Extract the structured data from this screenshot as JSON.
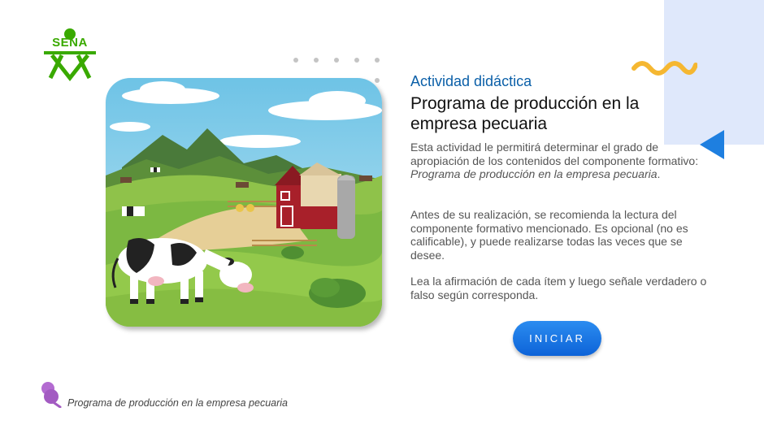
{
  "logo": {
    "text": "SENA",
    "color": "#39a900"
  },
  "header": {
    "subtitle": "Actividad didáctica",
    "title": "Programa de producción en la empresa pecuaria"
  },
  "body": {
    "p1_start": "Esta actividad le permitirá determinar el grado de apropiación de los contenidos del componente formativo: ",
    "p1_italic": "Programa de producción en la empresa pecuaria",
    "p1_end": ".",
    "p2": "Antes de su realización, se recomienda la lectura del componente formativo mencionado. Es opcional (no es calificable), y puede realizarse todas las veces que se desee.",
    "p3": "Lea la afirmación de cada ítem y luego señale verdadero o falso según corresponda."
  },
  "start_button": {
    "label": "INICIAR",
    "color": "#1a73e8"
  },
  "footer": {
    "text": "Programa de producción en la empresa pecuaria"
  },
  "icons": {
    "logo": "sena-logo-icon",
    "wave": "wave-decoration-icon",
    "back": "triangle-left-icon",
    "pin": "pushpin-icon",
    "illustration": "farm-illustration"
  },
  "colors": {
    "accent_blue": "#0a5fa8",
    "panel": "#dfe8fb",
    "wave": "#f5b731",
    "pin": "#a35bc2"
  }
}
